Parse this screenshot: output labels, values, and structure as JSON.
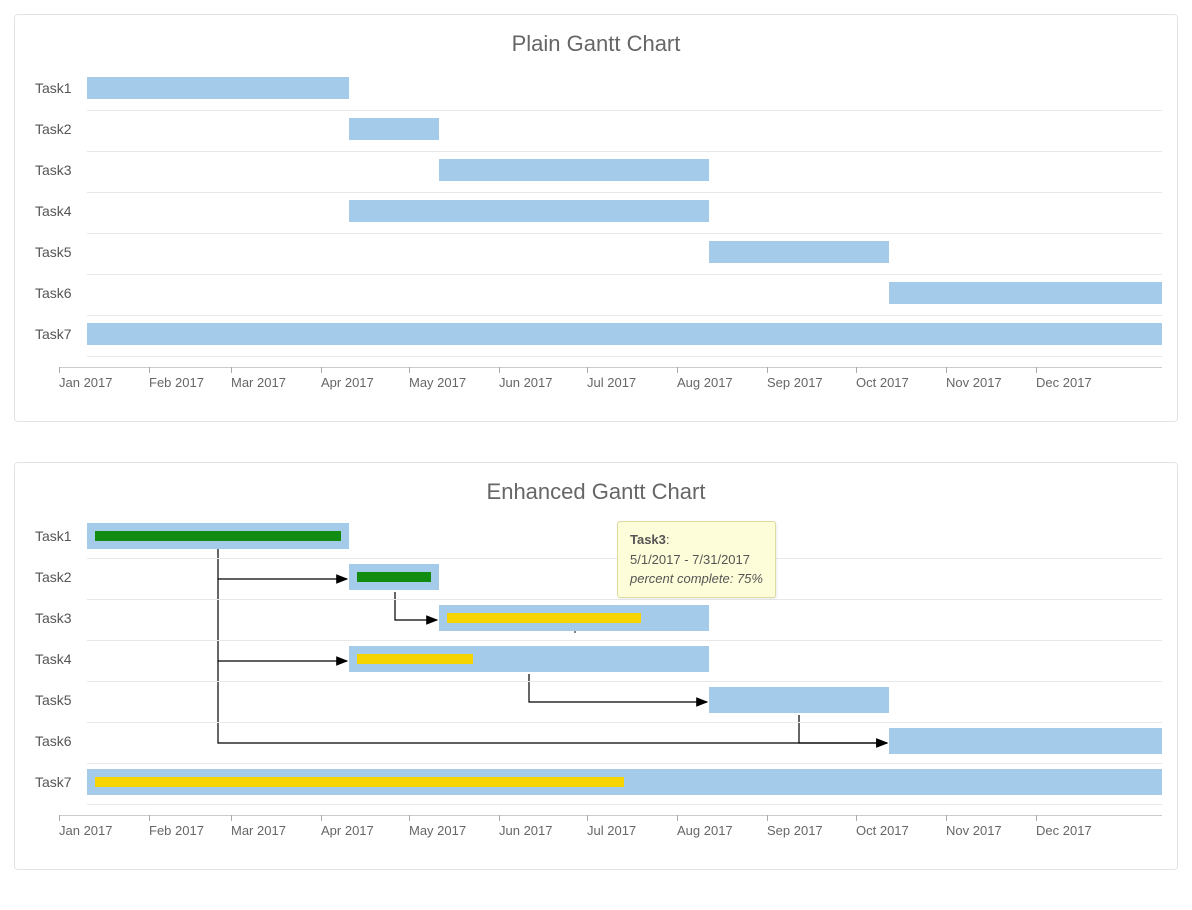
{
  "chart_data": [
    {
      "type": "gantt",
      "title": "Plain Gantt Chart",
      "x_axis": [
        "Jan 2017",
        "Feb 2017",
        "Mar 2017",
        "Apr 2017",
        "May 2017",
        "Jun 2017",
        "Jul 2017",
        "Aug 2017",
        "Sep 2017",
        "Oct 2017",
        "Nov 2017",
        "Dec 2017"
      ],
      "tasks": [
        {
          "name": "Task1",
          "start": "1/1/2017",
          "end": "3/31/2017"
        },
        {
          "name": "Task2",
          "start": "4/1/2017",
          "end": "4/30/2017"
        },
        {
          "name": "Task3",
          "start": "5/1/2017",
          "end": "7/31/2017"
        },
        {
          "name": "Task4",
          "start": "4/1/2017",
          "end": "7/31/2017"
        },
        {
          "name": "Task5",
          "start": "8/1/2017",
          "end": "9/30/2017"
        },
        {
          "name": "Task6",
          "start": "10/1/2017",
          "end": "12/31/2017"
        },
        {
          "name": "Task7",
          "start": "1/1/2017",
          "end": "12/31/2017"
        }
      ]
    },
    {
      "type": "gantt",
      "title": "Enhanced Gantt Chart",
      "x_axis": [
        "Jan 2017",
        "Feb 2017",
        "Mar 2017",
        "Apr 2017",
        "May 2017",
        "Jun 2017",
        "Jul 2017",
        "Aug 2017",
        "Sep 2017",
        "Oct 2017",
        "Nov 2017",
        "Dec 2017"
      ],
      "tasks": [
        {
          "name": "Task1",
          "start": "1/1/2017",
          "end": "3/31/2017",
          "percent_complete": 100,
          "progress_color": "#118c11"
        },
        {
          "name": "Task2",
          "start": "4/1/2017",
          "end": "4/30/2017",
          "percent_complete": 100,
          "progress_color": "#118c11"
        },
        {
          "name": "Task3",
          "start": "5/1/2017",
          "end": "7/31/2017",
          "percent_complete": 75,
          "progress_color": "#f5d400"
        },
        {
          "name": "Task4",
          "start": "4/1/2017",
          "end": "7/31/2017",
          "percent_complete": 33,
          "progress_color": "#f5d400"
        },
        {
          "name": "Task5",
          "start": "8/1/2017",
          "end": "9/30/2017",
          "percent_complete": 0
        },
        {
          "name": "Task6",
          "start": "10/1/2017",
          "end": "12/31/2017",
          "percent_complete": 0
        },
        {
          "name": "Task7",
          "start": "1/1/2017",
          "end": "12/31/2017",
          "percent_complete": 50,
          "progress_color": "#f5d400"
        }
      ],
      "dependencies": [
        [
          "Task1",
          "Task2"
        ],
        [
          "Task1",
          "Task4"
        ],
        [
          "Task1",
          "Task6"
        ],
        [
          "Task2",
          "Task3"
        ],
        [
          "Task4",
          "Task5"
        ],
        [
          "Task5",
          "Task6"
        ]
      ],
      "tooltip": {
        "task": "Task3",
        "range": "5/1/2017 - 7/31/2017",
        "pct_label": "percent complete: 75%"
      }
    }
  ],
  "colors": {
    "bar": "#a5cbea",
    "green": "#118c11",
    "yellow": "#f5d400"
  }
}
